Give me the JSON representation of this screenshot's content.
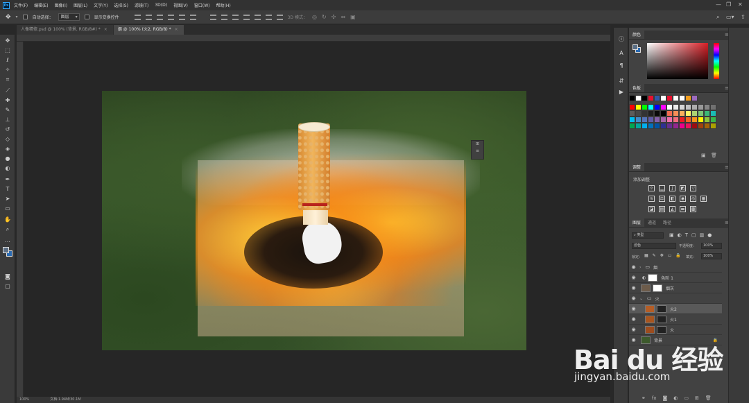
{
  "app": {
    "logo": "Ps"
  },
  "menubar": {
    "items": [
      "文件(F)",
      "编辑(E)",
      "图像(I)",
      "图层(L)",
      "文字(Y)",
      "选择(S)",
      "滤镜(T)",
      "3D(D)",
      "视图(V)",
      "窗口(W)",
      "帮助(H)"
    ]
  },
  "optionsbar": {
    "auto_select_label": "自动选择：",
    "auto_select_value": "图层",
    "show_transform_label": "显示变换控件",
    "mode_3d_label": "3D 模式："
  },
  "tabs": [
    {
      "label": "人像精修.psd @ 100% (背景, RGB/8#) *",
      "active": false
    },
    {
      "label": "烟 @ 100% (火2, RGB/8) *",
      "active": true
    }
  ],
  "statusbar": {
    "zoom": "100%",
    "doc": "文档:1.94M/30.1M"
  },
  "panels": {
    "color": {
      "tab": "颜色"
    },
    "swatches": {
      "tab": "色板"
    },
    "adjustments": {
      "tab": "调整",
      "subtitle": "添加调整"
    },
    "layers": {
      "tabs": [
        "图层",
        "通道",
        "路径"
      ],
      "kind_label": "类型",
      "blend_mode": "滤色",
      "opacity_label": "不透明度：",
      "opacity_value": "100%",
      "lock_label": "锁定：",
      "fill_label": "填充：",
      "fill_value": "100%",
      "rows": [
        {
          "name": "烟",
          "type": "group",
          "selected": false
        },
        {
          "name": "色阶 1",
          "type": "adjustment",
          "selected": false
        },
        {
          "name": "烟灰",
          "type": "layer",
          "selected": false
        },
        {
          "name": "火",
          "type": "group",
          "selected": false
        },
        {
          "name": "火2",
          "type": "layer",
          "selected": true
        },
        {
          "name": "火1",
          "type": "layer",
          "selected": false
        },
        {
          "name": "火",
          "type": "layer",
          "selected": false
        },
        {
          "name": "背景",
          "type": "layer",
          "selected": false
        }
      ]
    }
  },
  "swatch_colors": [
    "#ff0000",
    "#ffff00",
    "#00ff00",
    "#00ffff",
    "#0000ff",
    "#ff00ff",
    "#ffffff",
    "#ebebeb",
    "#d6d6d6",
    "#c2c2c2",
    "#adadad",
    "#999999",
    "#858585",
    "#707070",
    "#5c5c5c",
    "#474747",
    "#333333",
    "#1f1f1f",
    "#0a0a0a",
    "#000000",
    "#f26c4f",
    "#f68e56",
    "#fbaf5d",
    "#fff568",
    "#acd372",
    "#7cc576",
    "#3bb878",
    "#1abbb4",
    "#00bff3",
    "#438ccb",
    "#5574b9",
    "#605ca8",
    "#855fa8",
    "#a763a8",
    "#f06ea9",
    "#f26d7d",
    "#ed1c24",
    "#f26522",
    "#f7941d",
    "#fff200",
    "#8dc63f",
    "#39b54a",
    "#00a651",
    "#00a99d",
    "#00aeef",
    "#0072bc",
    "#0054a6",
    "#2e3192",
    "#662d91",
    "#92278f",
    "#ec008c",
    "#ed145b",
    "#9e0b0f",
    "#a0410d",
    "#a36209",
    "#aba000"
  ],
  "watermark": {
    "brand": "Bai du 经验",
    "url": "jingyan.baidu.com"
  }
}
